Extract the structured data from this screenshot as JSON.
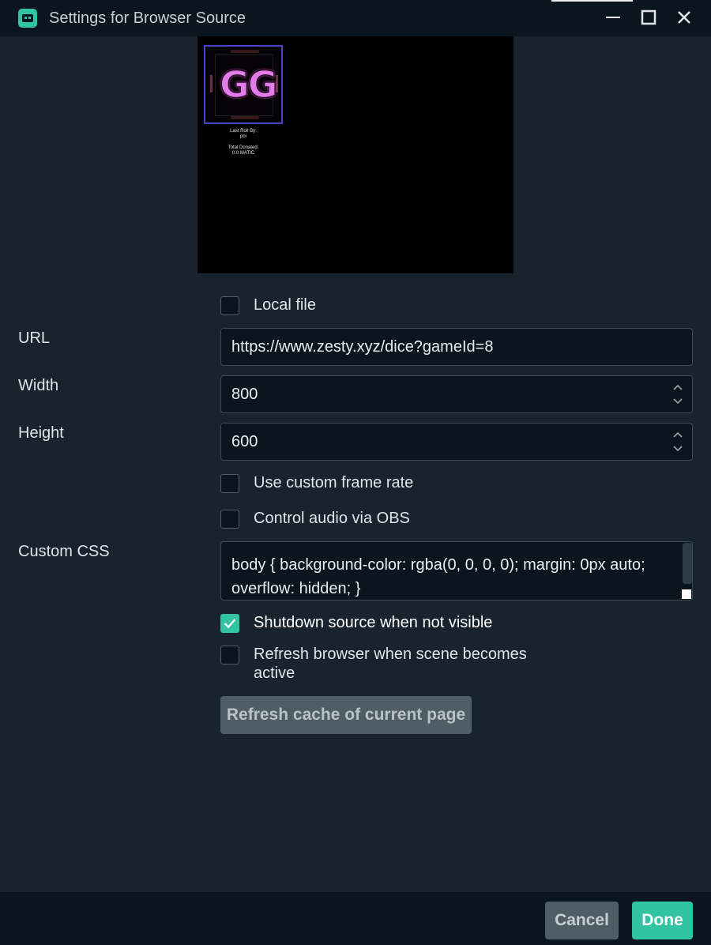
{
  "window": {
    "title": "Settings for Browser Source",
    "controls": {
      "minimize": "minimize-icon",
      "maximize": "maximize-icon",
      "close": "close-icon"
    }
  },
  "preview": {
    "widget_text": "GG",
    "last_roll_label": "Last Roll By:",
    "last_roll_value": "poi",
    "total_donated_label": "Total Donated:",
    "total_donated_value": "0.0 MATIC"
  },
  "form": {
    "local_file": {
      "label": "Local file",
      "checked": false
    },
    "url": {
      "label": "URL",
      "value": "https://www.zesty.xyz/dice?gameId=8"
    },
    "width": {
      "label": "Width",
      "value": "800"
    },
    "height": {
      "label": "Height",
      "value": "600"
    },
    "custom_frame_rate": {
      "label": "Use custom frame rate",
      "checked": false
    },
    "control_audio": {
      "label": "Control audio via OBS",
      "checked": false
    },
    "custom_css": {
      "label": "Custom CSS",
      "value": "body { background-color: rgba(0, 0, 0, 0); margin: 0px auto; overflow: hidden; }"
    },
    "shutdown_source": {
      "label": "Shutdown source when not visible",
      "checked": true
    },
    "refresh_browser": {
      "label_line1": "Refresh browser when scene becomes",
      "label_line2": "active",
      "checked": false
    },
    "refresh_cache_button": "Refresh cache of current page"
  },
  "footer": {
    "cancel_label": "Cancel",
    "done_label": "Done"
  },
  "colors": {
    "accent": "#31c3a2",
    "background": "#17242d",
    "input_bg": "#09161d",
    "button_gray": "#4f5e65"
  }
}
